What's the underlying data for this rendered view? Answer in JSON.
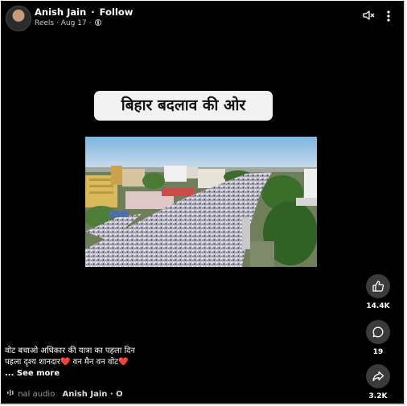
{
  "header": {
    "author": "Anish Jain",
    "separator": "·",
    "follow": "Follow",
    "type": "Reels",
    "date": "Aug 17",
    "dot": "·"
  },
  "icons": [
    "avatar",
    "globe-icon",
    "mute-icon",
    "more-icon",
    "like-icon",
    "comment-icon",
    "share-icon",
    "audio-icon"
  ],
  "overlay_title": "बिहार बदलाव की ओर",
  "actions": {
    "likes": "14.4K",
    "comments": "19",
    "shares": "3.2K"
  },
  "caption": {
    "line1": "वोट बचाओ अधिकार की यात्रा का पहला दिन",
    "line2": "पहला दृश्य शानदार❤️ वन मैन वन वोट❤️",
    "see_more": "... See more"
  },
  "audio": {
    "label": "nal audio",
    "author": "Anish Jain · O"
  },
  "colors": {
    "background": "#000000",
    "action_circle": "#3a3b3c",
    "title_box": "#f2f2f2"
  }
}
